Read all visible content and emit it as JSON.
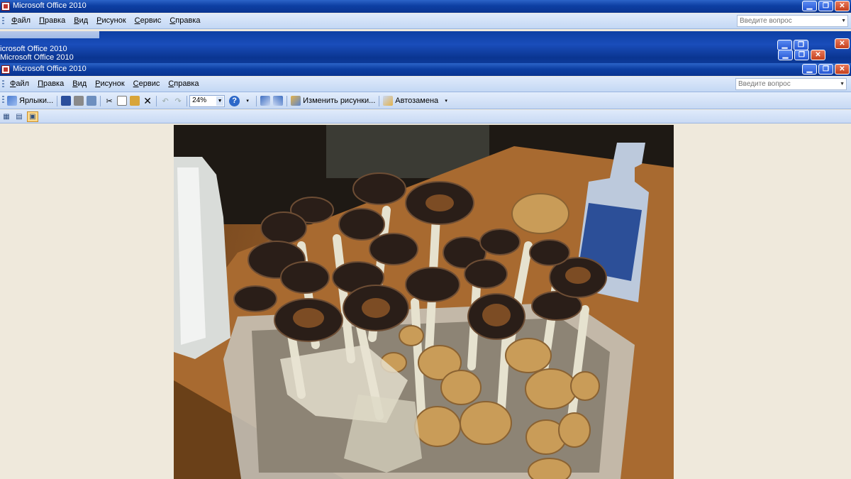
{
  "windows": [
    {
      "title": "Microsoft Office 2010"
    },
    {
      "title": "icrosoft Office 2010"
    },
    {
      "title": "Microsoft Office 2010"
    },
    {
      "title": "Microsoft Office 2010"
    }
  ],
  "menu": [
    "Файл",
    "Правка",
    "Вид",
    "Рисунок",
    "Сервис",
    "Справка"
  ],
  "help_placeholder": "Введите вопрос",
  "toolbar": {
    "shortcuts_label": "Ярлыки...",
    "zoom_value": "24%",
    "edit_picture_label": "Изменить рисунки...",
    "autocorrect_label": "Автозамена"
  },
  "view_modes": [
    "thumbnails",
    "filmstrip",
    "single-picture"
  ],
  "colors": {
    "titlebar": "#0d3fa3",
    "menubar": "#c4d8f4",
    "workspace": "#efe9dc"
  }
}
